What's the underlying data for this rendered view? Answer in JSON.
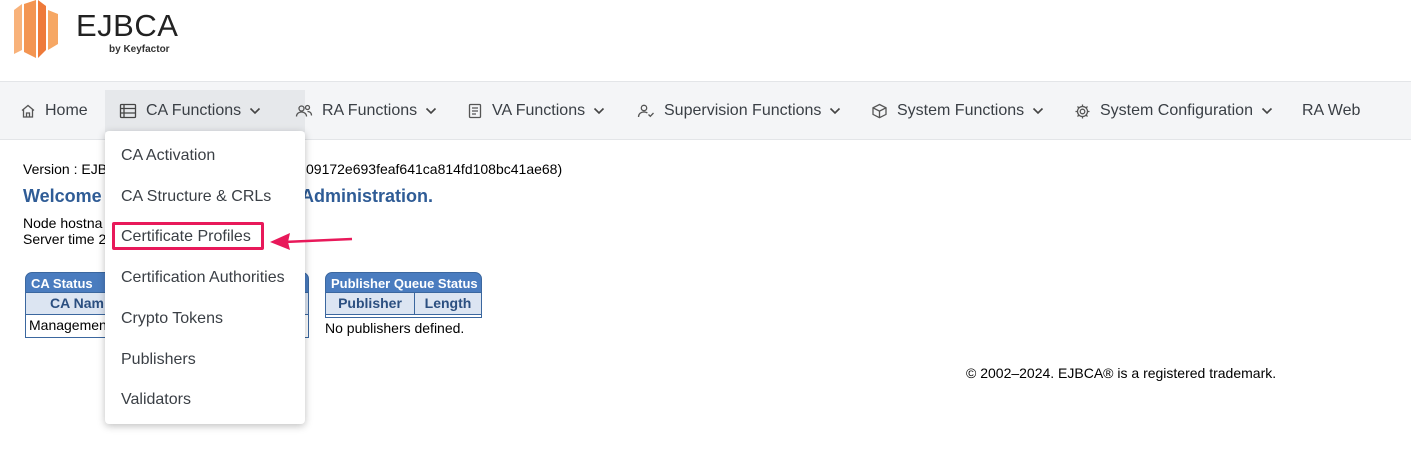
{
  "brand": {
    "name": "EJBCA",
    "sub": "by Keyfactor",
    "colors": {
      "orange_light": "#f6a15a",
      "orange_mid": "#f07d3a",
      "orange_dark": "#e8602a"
    }
  },
  "nav": {
    "items": [
      {
        "label": "Home",
        "icon": "home-icon"
      },
      {
        "label": "CA Functions",
        "icon": "list-icon"
      },
      {
        "label": "RA Functions",
        "icon": "users-icon"
      },
      {
        "label": "VA Functions",
        "icon": "document-icon"
      },
      {
        "label": "Supervision Functions",
        "icon": "user-check-icon"
      },
      {
        "label": "System Functions",
        "icon": "box-icon"
      },
      {
        "label": "System Configuration",
        "icon": "gear-icon"
      },
      {
        "label": "RA Web",
        "icon": ""
      }
    ]
  },
  "main": {
    "version_line": "Version : EJB",
    "version_tail": "09172e693feaf641ca814fd108bc41ae68)",
    "welcome_head": "Welcome",
    "welcome_tail": "Administration.",
    "node_host": "Node hostna",
    "server_time": "Server time 2"
  },
  "ca_status": {
    "title": "CA Status",
    "col1": "CA Nam",
    "row1": "Managemen"
  },
  "publisher_queue": {
    "title": "Publisher Queue Status",
    "col1": "Publisher",
    "col2": "Length",
    "empty": "No publishers defined."
  },
  "footer": {
    "text": "© 2002–2024. EJBCA® is a registered trademark."
  },
  "dropdown": {
    "items": [
      "CA Activation",
      "CA Structure & CRLs",
      "Certificate Profiles",
      "Certification Authorities",
      "Crypto Tokens",
      "Publishers",
      "Validators"
    ],
    "highlight_color": "#e8195a"
  }
}
